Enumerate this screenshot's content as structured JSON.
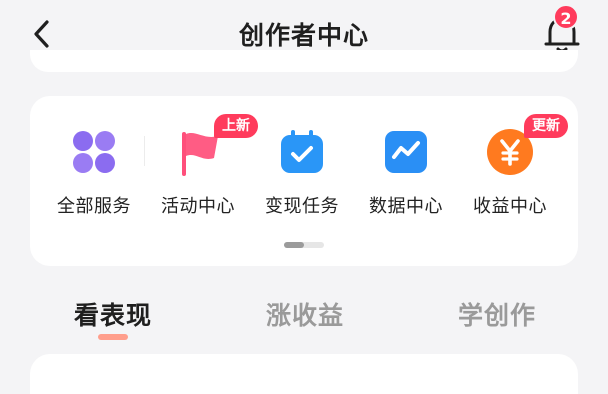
{
  "header": {
    "title": "创作者中心",
    "notification_count": "2"
  },
  "services": {
    "items": [
      {
        "label": "全部服务",
        "icon": "grid-icon",
        "badge": ""
      },
      {
        "label": "活动中心",
        "icon": "flag-icon",
        "badge": "上新"
      },
      {
        "label": "变现任务",
        "icon": "calendar-check-icon",
        "badge": ""
      },
      {
        "label": "数据中心",
        "icon": "chart-icon",
        "badge": ""
      },
      {
        "label": "收益中心",
        "icon": "yuan-icon",
        "badge": "更新"
      }
    ],
    "page_index": 1,
    "page_count": 2
  },
  "tabs": [
    {
      "label": "看表现",
      "active": true
    },
    {
      "label": "涨收益",
      "active": false
    },
    {
      "label": "学创作",
      "active": false
    }
  ],
  "colors": {
    "badge": "#ff3b5c",
    "tab_underline": "#ff9e8c",
    "grid_icon": "#8b6cf0",
    "flag_icon": "#ff4f7b",
    "task_icon": "#2a96f7",
    "data_icon": "#2a8ff5",
    "revenue_icon": "#ff7a1f"
  }
}
